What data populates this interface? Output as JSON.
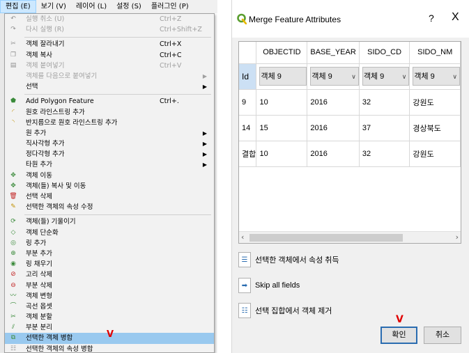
{
  "menubar": {
    "items": [
      "편집 (E)",
      "보기 (V)",
      "레이어 (L)",
      "설정 (S)",
      "플러그인 (P)"
    ]
  },
  "edit_menu": {
    "items": [
      {
        "label": "실행 취소 (U)",
        "shortcut": "Ctrl+Z",
        "disabled": true,
        "icon": "undo-icon"
      },
      {
        "label": "다시 실행 (R)",
        "shortcut": "Ctrl+Shift+Z",
        "disabled": true,
        "icon": "redo-icon"
      },
      {
        "sep": true
      },
      {
        "label": "객체 잘라내기",
        "shortcut": "Ctrl+X",
        "icon": "cut-icon"
      },
      {
        "label": "객체 복사",
        "shortcut": "Ctrl+C",
        "icon": "copy-icon"
      },
      {
        "label": "객체 붙여넣기",
        "shortcut": "Ctrl+V",
        "disabled": true,
        "icon": "paste-icon"
      },
      {
        "label": "객체를 다음으로 붙여넣기",
        "disabled": true,
        "submenu": true
      },
      {
        "label": "선택",
        "submenu": true
      },
      {
        "sep": true
      },
      {
        "label": "Add Polygon Feature",
        "shortcut": "Ctrl+.",
        "icon": "add-polygon-icon"
      },
      {
        "label": "원호 라인스트링 추가",
        "icon": "add-circular-string-icon"
      },
      {
        "label": "반지름으로 원호 라인스트링 추가",
        "icon": "add-circular-string-radius-icon"
      },
      {
        "label": "원 추가",
        "submenu": true
      },
      {
        "label": "직사각형 추가",
        "submenu": true
      },
      {
        "label": "정다각형 추가",
        "submenu": true
      },
      {
        "label": "타원 추가",
        "submenu": true
      },
      {
        "label": "객체 이동",
        "icon": "move-feature-icon"
      },
      {
        "label": "객체(들) 복사 및 이동",
        "icon": "copy-move-feature-icon"
      },
      {
        "label": "선택 삭제",
        "icon": "delete-selected-icon"
      },
      {
        "label": "선택한 객체의 속성 수정",
        "icon": "modify-attributes-icon"
      },
      {
        "sep": true
      },
      {
        "label": "객체(들) 기울이기",
        "icon": "rotate-feature-icon"
      },
      {
        "label": "객체 단순화",
        "icon": "simplify-feature-icon"
      },
      {
        "label": "링 추가",
        "icon": "add-ring-icon"
      },
      {
        "label": "부분 추가",
        "icon": "add-part-icon"
      },
      {
        "label": "링 채우기",
        "icon": "fill-ring-icon"
      },
      {
        "label": "고리 삭제",
        "icon": "delete-ring-icon"
      },
      {
        "label": "부분 삭제",
        "icon": "delete-part-icon"
      },
      {
        "label": "객체 변형",
        "icon": "reshape-feature-icon"
      },
      {
        "label": "곡선 옵셋",
        "icon": "offset-curve-icon"
      },
      {
        "label": "객체 분할",
        "icon": "split-feature-icon"
      },
      {
        "label": "부분 분리",
        "icon": "split-parts-icon"
      },
      {
        "label": "선택한 객체 병합",
        "icon": "merge-features-icon",
        "highlight": true,
        "mark": "V"
      },
      {
        "label": "선택한 객체의 속성 병합",
        "icon": "merge-attributes-icon"
      }
    ]
  },
  "dialog": {
    "title": "Merge Feature Attributes",
    "help": "?",
    "close": "X",
    "columns": [
      "OBJECTID",
      "BASE_YEAR",
      "SIDO_CD",
      "SIDO_NM"
    ],
    "id_header": "Id",
    "combo_value": "객체 9",
    "rows": [
      {
        "id": "9",
        "values": [
          "10",
          "2016",
          "32",
          "강원도"
        ]
      },
      {
        "id": "14",
        "values": [
          "15",
          "2016",
          "37",
          "경상북도"
        ]
      },
      {
        "id": "결합",
        "values": [
          "10",
          "2016",
          "32",
          "강원도"
        ]
      }
    ],
    "actions": [
      {
        "label": "선택한 객체에서 속성 취득",
        "icon": "take-attributes-icon"
      },
      {
        "label": "Skip all fields",
        "icon": "skip-fields-icon"
      },
      {
        "label": "선택 집합에서 객체 제거",
        "icon": "remove-from-selection-icon"
      }
    ],
    "ok_label": "확인",
    "cancel_label": "취소",
    "ok_mark": "V"
  }
}
